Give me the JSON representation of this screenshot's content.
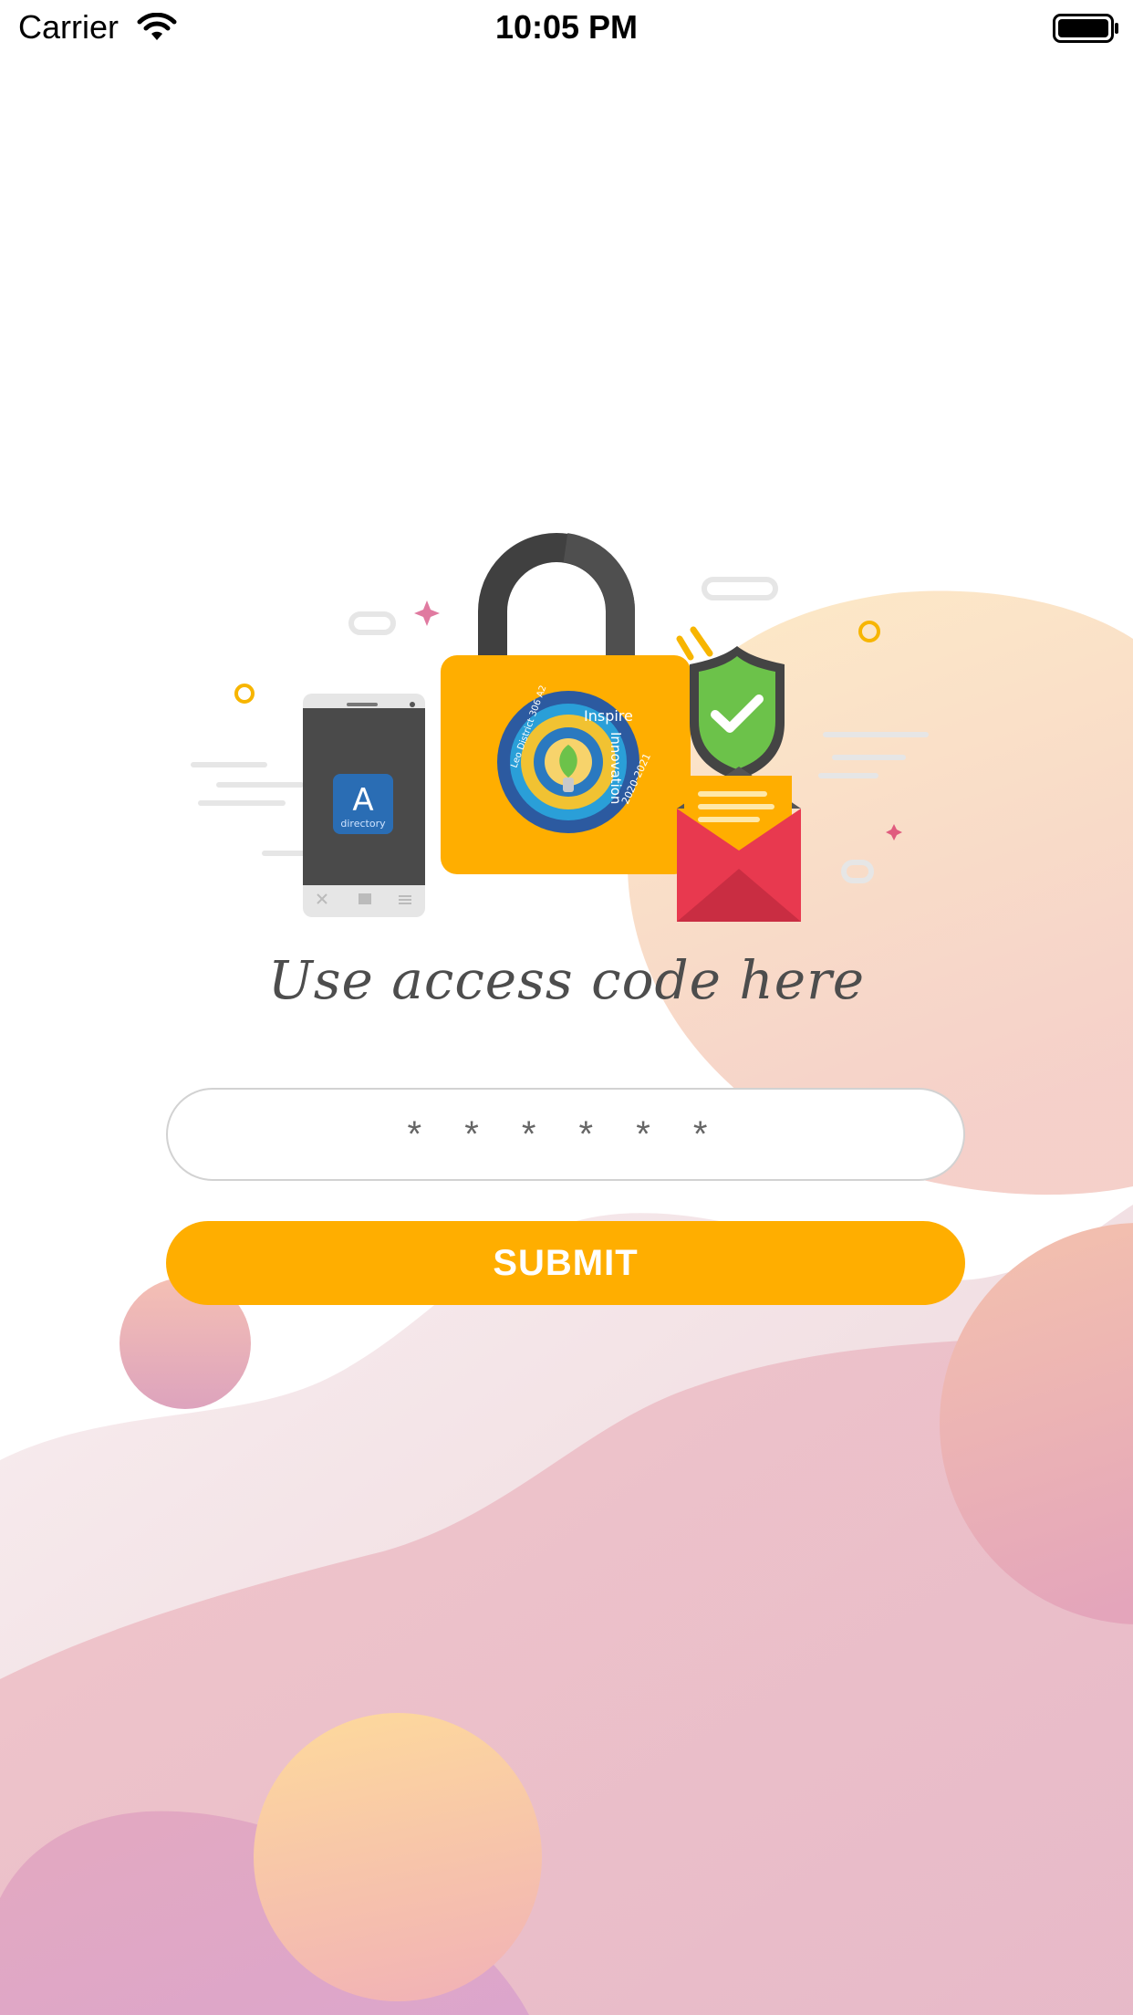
{
  "status_bar": {
    "carrier": "Carrier",
    "time": "10:05 PM",
    "wifi_icon": "wifi-icon",
    "battery_icon": "battery-icon"
  },
  "illustration": {
    "app_logo_text": "A",
    "app_logo_subtext": "directory",
    "badge_top_text": "Inspire",
    "badge_side_text": "Innovation",
    "badge_year_text": "2020-2021",
    "badge_rim_text": "Leo District 306 A2",
    "icons": [
      "phone-icon",
      "padlock-icon",
      "badge-icon",
      "shield-check-icon",
      "envelope-icon"
    ]
  },
  "heading": "Use access code here",
  "form": {
    "code_placeholder": "* * * * * *",
    "code_value": "",
    "submit_label": "SUBMIT"
  },
  "colors": {
    "accent": "#FFAE00",
    "heading_text": "#4D4D4D",
    "shield": "#6CC24A",
    "envelope": "#E8394F"
  }
}
